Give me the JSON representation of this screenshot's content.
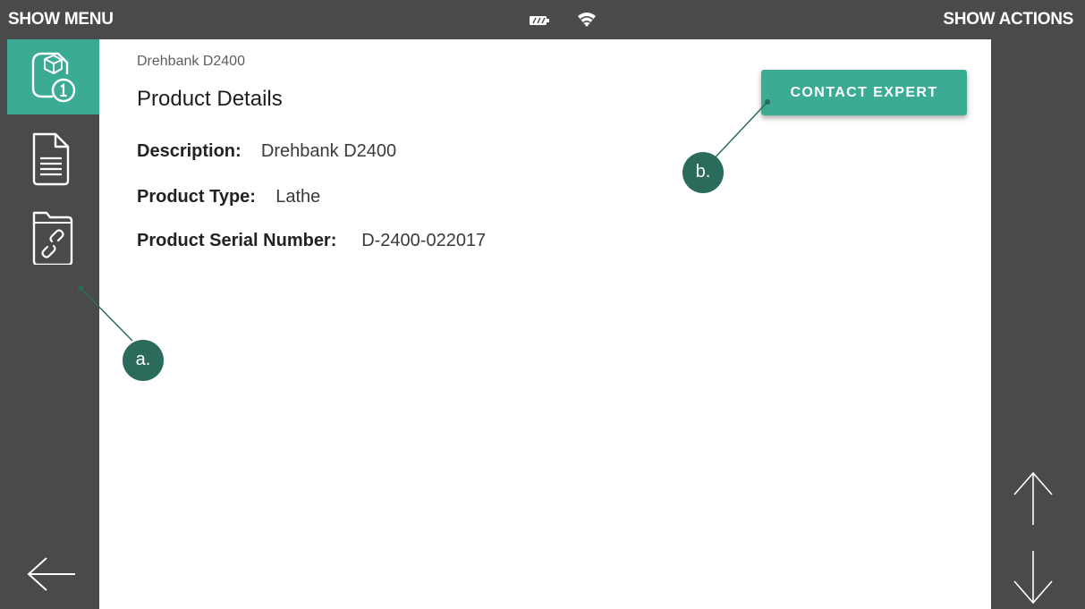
{
  "topbar": {
    "show_menu": "SHOW MENU",
    "show_actions": "SHOW ACTIONS",
    "battery_icon": "battery-icon",
    "wifi_icon": "wifi-icon"
  },
  "sidebar": {
    "items": [
      {
        "icon": "product-info-icon",
        "active": true
      },
      {
        "icon": "document-icon",
        "active": false
      },
      {
        "icon": "linked-folder-icon",
        "active": false
      }
    ],
    "back_icon": "arrow-left-icon"
  },
  "main": {
    "subtitle": "Drehbank D2400",
    "title": "Product Details",
    "fields": [
      {
        "label": "Description:",
        "value": "Drehbank D2400"
      },
      {
        "label": "Product Type:",
        "value": "Lathe"
      },
      {
        "label": "Product Serial Number:",
        "value": "D-2400-022017"
      }
    ],
    "contact_button": "CONTACT EXPERT"
  },
  "callouts": {
    "a": "a.",
    "b": "b."
  },
  "rightbar": {
    "up_icon": "arrow-up-icon",
    "down_icon": "arrow-down-icon"
  },
  "colors": {
    "accent": "#3bab94",
    "chrome": "#4a4a4a",
    "callout": "#2b6b5c"
  }
}
